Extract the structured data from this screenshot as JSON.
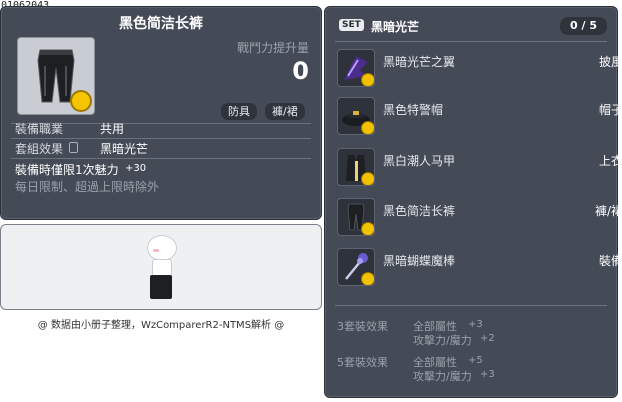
{
  "item_id": "01062043",
  "item": {
    "title": "黑色简洁长裤",
    "power_label": "戰鬥力提升量",
    "power_value": "0",
    "tags": [
      "防具",
      "褲/裙"
    ],
    "job_label": "裝備職業",
    "job_value": "共用",
    "set_label": "套組效果",
    "set_value": "黑暗光芒",
    "charm_text": "裝備時僅限1次魅力",
    "charm_value": "+30",
    "daily_limit": "每日限制、超過上限時除外"
  },
  "footer_credit": "@ 数据由小册子整理，WzComparerR2-NTMS解析 @",
  "set_panel": {
    "badge": "SET",
    "name": "黑暗光芒",
    "count": "0 / 5",
    "items": [
      {
        "name": "黑暗光芒之翼",
        "slot": "披風",
        "icon": "dark-wing-icon"
      },
      {
        "name": "黑色特警帽",
        "slot": "帽子",
        "icon": "police-hat-icon"
      },
      {
        "name": "黑白潮人马甲",
        "slot": "上衣",
        "icon": "vest-icon"
      },
      {
        "name": "黑色简洁长裤",
        "slot": "褲/裙",
        "icon": "pants-icon"
      },
      {
        "name": "黑暗蝴蝶魔棒",
        "slot": "裝備",
        "icon": "butterfly-wand-icon"
      }
    ],
    "effects": [
      {
        "label": "3套裝效果",
        "lines": [
          {
            "stat": "全部屬性",
            "value": "+3"
          },
          {
            "stat": "攻擊力/魔力",
            "value": "+2"
          }
        ]
      },
      {
        "label": "5套裝效果",
        "lines": [
          {
            "stat": "全部屬性",
            "value": "+5"
          },
          {
            "stat": "攻擊力/魔力",
            "value": "+3"
          }
        ]
      }
    ]
  }
}
